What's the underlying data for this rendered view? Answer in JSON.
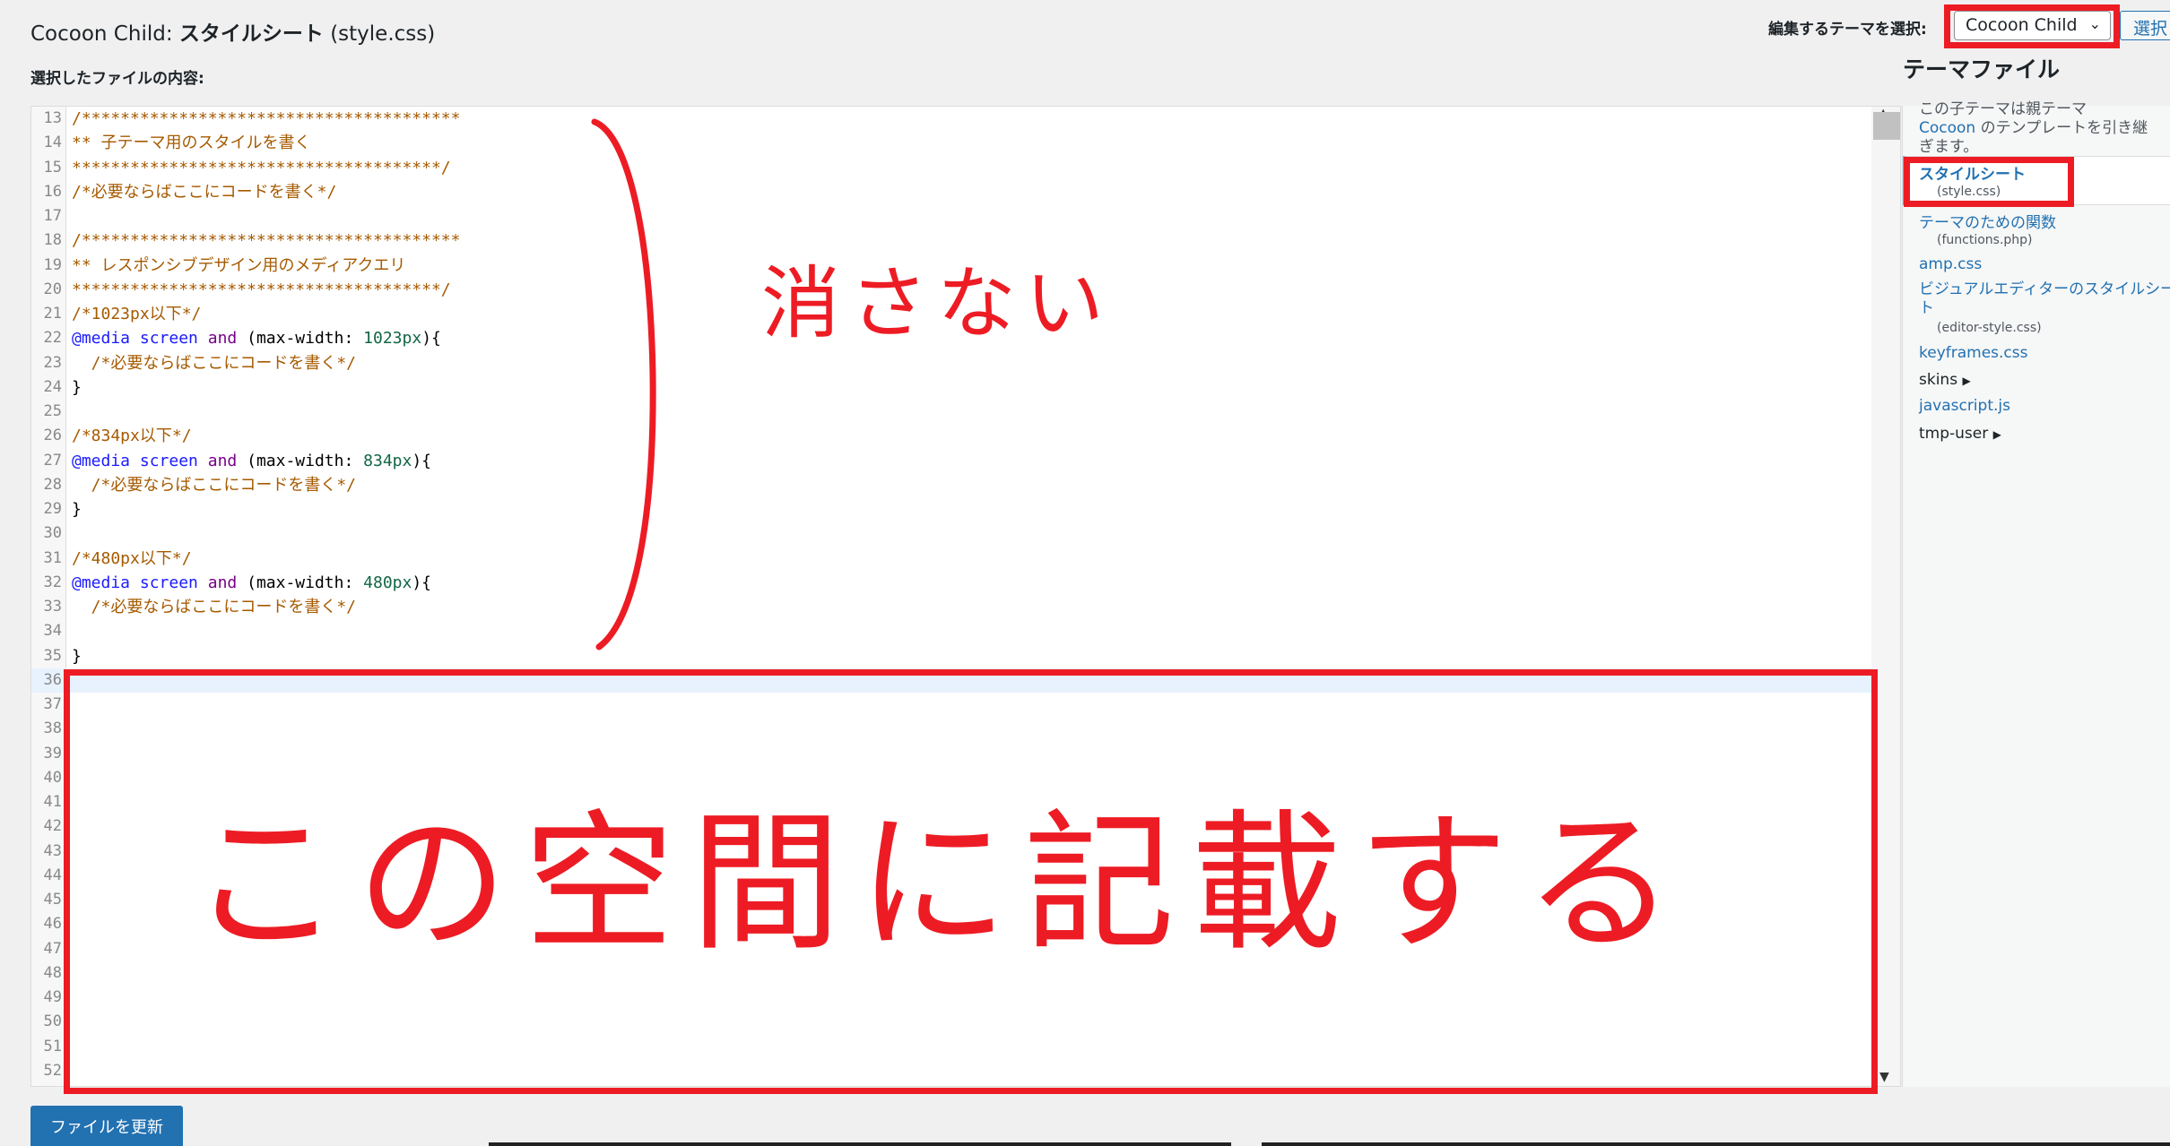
{
  "header": {
    "title_prefix": "Cocoon Child:",
    "title_main": "スタイルシート",
    "title_suffix": "(style.css)",
    "content_label": "選択したファイルの内容:"
  },
  "theme_picker": {
    "label": "編集するテーマを選択:",
    "selected": "Cocoon Child",
    "select_button": "選択"
  },
  "editor": {
    "active_line": 36,
    "lines": [
      {
        "n": "13",
        "t": [
          [
            "c",
            "/***************************************"
          ]
        ]
      },
      {
        "n": "14",
        "t": [
          [
            "c",
            "** 子テーマ用のスタイルを書く"
          ]
        ]
      },
      {
        "n": "15",
        "t": [
          [
            "c",
            "**************************************/"
          ]
        ]
      },
      {
        "n": "16",
        "t": [
          [
            "c",
            "/*必要ならばここにコードを書く*/"
          ]
        ]
      },
      {
        "n": "17",
        "t": []
      },
      {
        "n": "18",
        "t": [
          [
            "c",
            "/***************************************"
          ]
        ]
      },
      {
        "n": "19",
        "t": [
          [
            "c",
            "** レスポンシブデザイン用のメディアクエリ"
          ]
        ]
      },
      {
        "n": "20",
        "t": [
          [
            "c",
            "**************************************/"
          ]
        ]
      },
      {
        "n": "21",
        "t": [
          [
            "c",
            "/*1023px以下*/"
          ]
        ]
      },
      {
        "n": "22",
        "t": [
          [
            "kw",
            "@media"
          ],
          [
            "p",
            " "
          ],
          [
            "sel",
            "screen"
          ],
          [
            "p",
            " "
          ],
          [
            "and",
            "and"
          ],
          [
            "p",
            " (max-width: "
          ],
          [
            "num",
            "1023px"
          ],
          [
            "p",
            "){"
          ]
        ]
      },
      {
        "n": "23",
        "t": [
          [
            "c",
            "  /*必要ならばここにコードを書く*/"
          ]
        ]
      },
      {
        "n": "24",
        "t": [
          [
            "p",
            "}"
          ]
        ]
      },
      {
        "n": "25",
        "t": []
      },
      {
        "n": "26",
        "t": [
          [
            "c",
            "/*834px以下*/"
          ]
        ]
      },
      {
        "n": "27",
        "t": [
          [
            "kw",
            "@media"
          ],
          [
            "p",
            " "
          ],
          [
            "sel",
            "screen"
          ],
          [
            "p",
            " "
          ],
          [
            "and",
            "and"
          ],
          [
            "p",
            " (max-width: "
          ],
          [
            "num",
            "834px"
          ],
          [
            "p",
            "){"
          ]
        ]
      },
      {
        "n": "28",
        "t": [
          [
            "c",
            "  /*必要ならばここにコードを書く*/"
          ]
        ]
      },
      {
        "n": "29",
        "t": [
          [
            "p",
            "}"
          ]
        ]
      },
      {
        "n": "30",
        "t": []
      },
      {
        "n": "31",
        "t": [
          [
            "c",
            "/*480px以下*/"
          ]
        ]
      },
      {
        "n": "32",
        "t": [
          [
            "kw",
            "@media"
          ],
          [
            "p",
            " "
          ],
          [
            "sel",
            "screen"
          ],
          [
            "p",
            " "
          ],
          [
            "and",
            "and"
          ],
          [
            "p",
            " (max-width: "
          ],
          [
            "num",
            "480px"
          ],
          [
            "p",
            "){"
          ]
        ]
      },
      {
        "n": "33",
        "t": [
          [
            "c",
            "  /*必要ならばここにコードを書く*/"
          ]
        ]
      },
      {
        "n": "34",
        "t": []
      },
      {
        "n": "35",
        "t": [
          [
            "p",
            "}"
          ]
        ]
      },
      {
        "n": "36",
        "t": []
      },
      {
        "n": "37",
        "t": []
      },
      {
        "n": "38",
        "t": []
      },
      {
        "n": "39",
        "t": []
      },
      {
        "n": "40",
        "t": []
      },
      {
        "n": "41",
        "t": []
      },
      {
        "n": "42",
        "t": []
      },
      {
        "n": "43",
        "t": []
      },
      {
        "n": "44",
        "t": []
      },
      {
        "n": "45",
        "t": []
      },
      {
        "n": "46",
        "t": []
      },
      {
        "n": "47",
        "t": []
      },
      {
        "n": "48",
        "t": []
      },
      {
        "n": "49",
        "t": []
      },
      {
        "n": "50",
        "t": []
      },
      {
        "n": "51",
        "t": []
      },
      {
        "n": "52",
        "t": []
      }
    ]
  },
  "sidebar": {
    "heading": "テーマファイル",
    "desc_1": "この子テーマは親テーマ",
    "desc_parent": "Cocoon",
    "desc_2": " のテンプレートを引き継ぎます。",
    "files": [
      {
        "label": "スタイルシート",
        "file": "(style.css)"
      },
      {
        "label": "テーマのための関数",
        "file": "(functions.php)"
      },
      {
        "label": "amp.css"
      },
      {
        "label": "ビジュアルエディターのスタイルシート",
        "file": "(editor-style.css)"
      },
      {
        "label": "keyframes.css"
      },
      {
        "label": "skins",
        "folder": true
      },
      {
        "label": "javascript.js"
      },
      {
        "label": "tmp-user",
        "folder": true
      }
    ]
  },
  "footer": {
    "update_button": "ファイルを更新"
  },
  "annotations": {
    "keep": "消さない",
    "write_here": "この空間に記載する",
    "color": "#ed1c24"
  }
}
